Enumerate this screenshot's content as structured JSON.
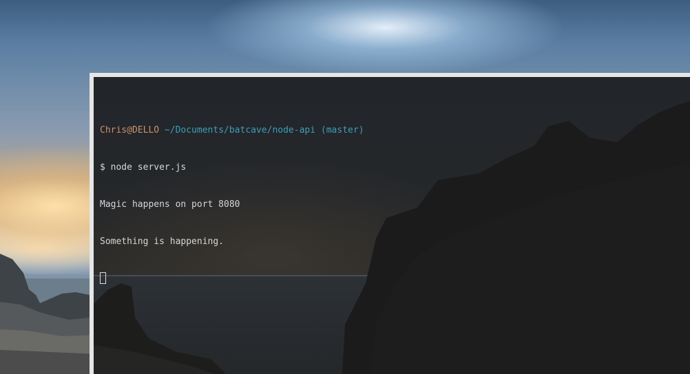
{
  "terminal": {
    "prompt": {
      "user_host": "Chris@DELLO",
      "path": "~/Documents/batcave/node-api",
      "branch": "(master)"
    },
    "lines": [
      "$ node server.js",
      "Magic happens on port 8080",
      "Something is happening."
    ]
  },
  "colors": {
    "prompt_user": "#c8936b",
    "prompt_path": "#3c9fb8",
    "text": "#d6d6d6",
    "window_frame": "#e6e6e6"
  }
}
